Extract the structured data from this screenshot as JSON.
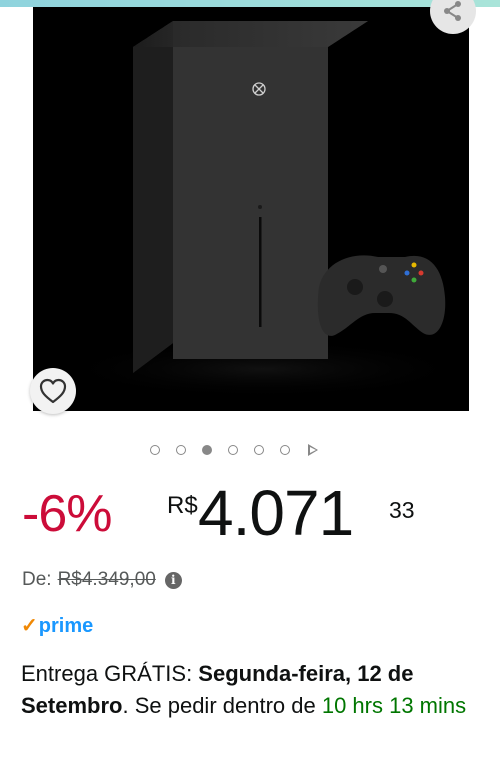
{
  "colors": {
    "discount": "#cc0c39",
    "prime_check": "#f08804",
    "prime_text": "#1a98ff",
    "countdown": "#007600"
  },
  "image": {
    "carousel_total": 6,
    "carousel_active_index": 3
  },
  "icons": {
    "share": "share-icon",
    "favorite": "heart-icon",
    "info": "info-icon",
    "next": "carousel-next-icon"
  },
  "price": {
    "discount": "-6%",
    "currency": "R$",
    "whole": "4.071",
    "fraction": "33",
    "list_label": "De:",
    "list_price": "R$4.349,00",
    "info_glyph": "i"
  },
  "prime": {
    "check": "✓",
    "label": "prime"
  },
  "delivery": {
    "prefix": "Entrega GRÁTIS: ",
    "date": "Segunda-feira, 12 de Setembro",
    "middle": ". Se pedir dentro de ",
    "countdown": "10 hrs 13 mins"
  }
}
